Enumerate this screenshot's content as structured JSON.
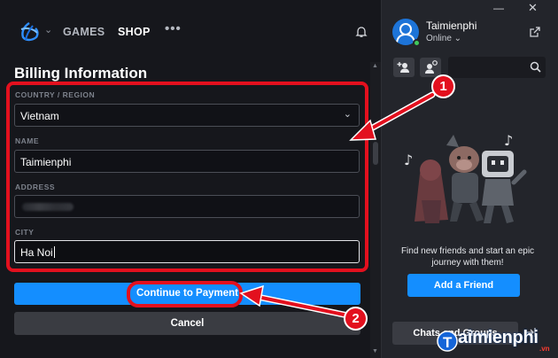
{
  "nav": {
    "games": "GAMES",
    "shop": "SHOP",
    "more": "•••"
  },
  "billing": {
    "title": "Billing Information",
    "country_label": "COUNTRY / REGION",
    "country_value": "Vietnam",
    "name_label": "NAME",
    "name_value": "Taimienphi",
    "address_label": "ADDRESS",
    "address_value": "",
    "city_label": "CITY",
    "city_value": "Ha Noi",
    "continue_label": "Continue to Payment",
    "cancel_label": "Cancel"
  },
  "social": {
    "username": "Taimienphi",
    "status": "Online",
    "empty_message": "Find new friends and start an epic journey with them!",
    "add_friend_label": "Add a Friend",
    "chat_tab_label": "Chats and Groups"
  },
  "watermark": {
    "text": "aimienphi",
    "suffix": ".vn"
  },
  "annotations": {
    "step1": "1",
    "step2": "2"
  },
  "colors": {
    "accent": "#148eff",
    "annotation": "#e3101e",
    "online": "#41c95c"
  }
}
